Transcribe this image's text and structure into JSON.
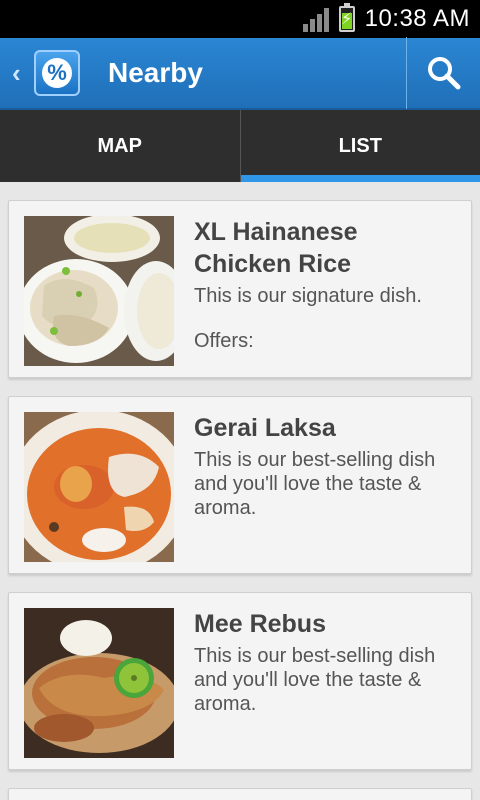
{
  "status_bar": {
    "time": "10:38 AM"
  },
  "action_bar": {
    "title": "Nearby",
    "logo_symbol": "%"
  },
  "tabs": [
    {
      "label": "MAP",
      "active": false
    },
    {
      "label": "LIST",
      "active": true
    }
  ],
  "items": [
    {
      "name": "XL Hainanese Chicken Rice",
      "description": "This is our signature dish.",
      "offers_label": "Offers:",
      "image": "chicken-rice-photo"
    },
    {
      "name": "Gerai Laksa",
      "description": "This is our best-selling dish and you'll love the taste & aroma.",
      "image": "laksa-photo"
    },
    {
      "name": "Mee Rebus",
      "description": "This is our best-selling dish and you'll love the taste & aroma.",
      "image": "mee-rebus-photo"
    }
  ],
  "colors": {
    "action_bar": "#2b86d3",
    "tab_indicator": "#2f96e8",
    "tab_bar": "#2e2e2e"
  }
}
